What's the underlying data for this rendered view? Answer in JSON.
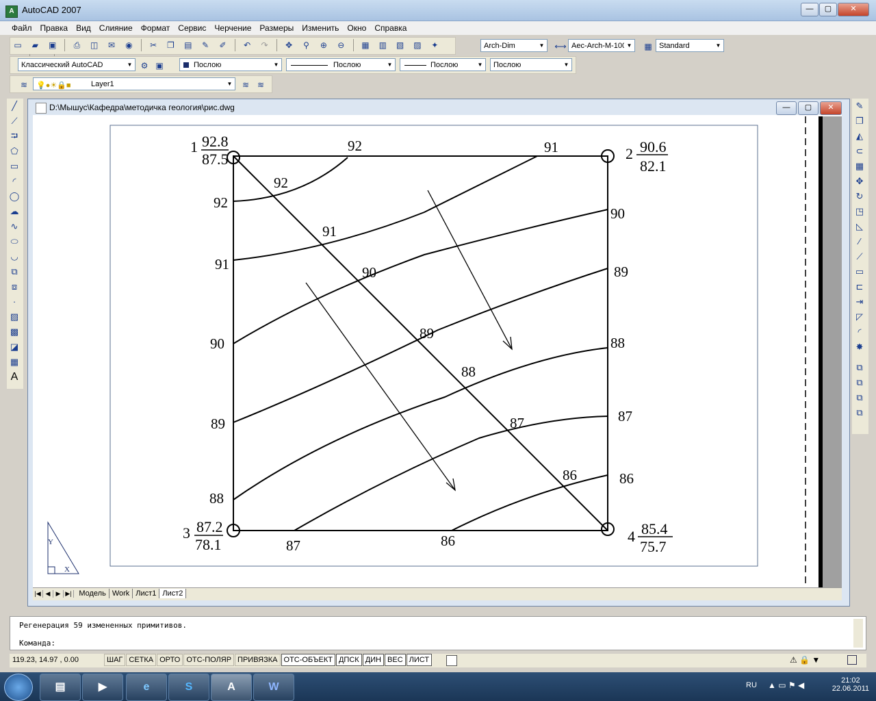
{
  "window": {
    "title": "AutoCAD 2007",
    "minimize": "—",
    "maximize": "▢",
    "close": "✕"
  },
  "menu": [
    "Файл",
    "Правка",
    "Вид",
    "Слияние",
    "Формат",
    "Сервис",
    "Черчение",
    "Размеры",
    "Изменить",
    "Окно",
    "Справка"
  ],
  "toolbar": {
    "text_style": "Arch-Dim",
    "dim_style": "Aec-Arch-M-100",
    "table_style": "Standard",
    "workspace": "Классический AutoCAD",
    "color": "Послою",
    "linetype": "Послою",
    "lineweight": "Послою",
    "plotstyle": "Послою",
    "layer": "Layer1"
  },
  "drawing": {
    "path": "D:\\Мышус\\Кафедра\\методичка геология\\рис.dwg",
    "corners": [
      {
        "num": "1",
        "top": "92.8",
        "bottom": "87.5"
      },
      {
        "num": "2",
        "top": "90.6",
        "bottom": "82.1"
      },
      {
        "num": "3",
        "top": "87.2",
        "bottom": "78.1"
      },
      {
        "num": "4",
        "top": "85.4",
        "bottom": "75.7"
      }
    ],
    "left_labels": [
      "92",
      "91",
      "90",
      "89",
      "88"
    ],
    "right_labels": [
      "90",
      "89",
      "88",
      "87",
      "86"
    ],
    "top_labels": [
      "92",
      "91"
    ],
    "bottom_labels": [
      "87",
      "86"
    ],
    "diag_labels": [
      "92",
      "91",
      "90",
      "89",
      "88",
      "87",
      "86"
    ],
    "ucs": {
      "y": "Y",
      "x": "X"
    }
  },
  "tabs": [
    "Модель",
    "Work",
    "Лист1",
    "Лист2"
  ],
  "command": {
    "history": "Регенерация 59 измененных примитивов.",
    "prompt": "Команда:"
  },
  "status": {
    "coords": "119.23,   14.97  , 0.00",
    "buttons": [
      {
        "label": "ШАГ",
        "on": false
      },
      {
        "label": "СЕТКА",
        "on": false
      },
      {
        "label": "ОРТО",
        "on": false
      },
      {
        "label": "ОТС-ПОЛЯР",
        "on": false
      },
      {
        "label": "ПРИВЯЗКА",
        "on": false
      },
      {
        "label": "ОТС-ОБЪЕКТ",
        "on": true
      },
      {
        "label": "ДПСК",
        "on": true
      },
      {
        "label": "ДИН",
        "on": true
      },
      {
        "label": "ВЕС",
        "on": true
      },
      {
        "label": "ЛИСТ",
        "on": true
      }
    ]
  },
  "taskbar": {
    "lang": "RU",
    "time": "21:02",
    "date": "22.06.2011"
  }
}
